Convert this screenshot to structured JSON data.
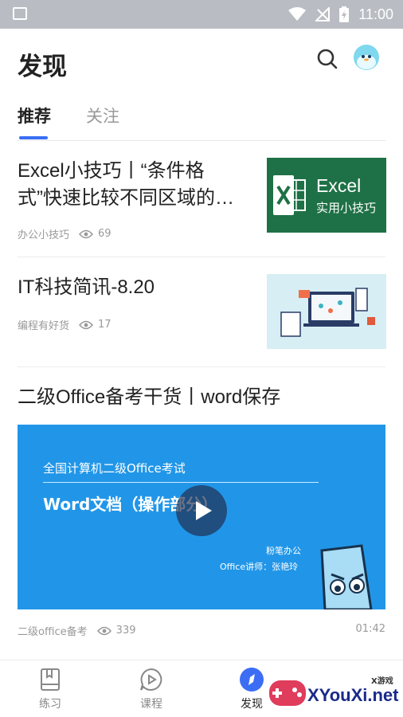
{
  "status_bar": {
    "time": "11:00"
  },
  "header": {
    "title": "发现"
  },
  "tabs": [
    {
      "label": "推荐",
      "active": true
    },
    {
      "label": "关注",
      "active": false
    }
  ],
  "articles": [
    {
      "title": "Excel小技巧丨“条件格式”快速比较不同区域的…",
      "source": "办公小技巧",
      "views": "69",
      "thumbnail": {
        "brand": "Excel",
        "caption": "实用小技巧"
      }
    },
    {
      "title": "IT科技简讯-8.20",
      "source": "编程有好货",
      "views": "17"
    },
    {
      "title": "二级Office备考干货丨word保存",
      "source": "二级office备考",
      "views": "339",
      "duration": "01:42",
      "video": {
        "exam_title": "全国计算机二级Office考试",
        "doc_title": "Word文档（操作部分）",
        "brand": "粉笔办公",
        "teacher": "Office讲师：张艳玲"
      }
    }
  ],
  "bottom_nav": [
    {
      "label": "练习",
      "icon": "book-icon",
      "active": false
    },
    {
      "label": "课程",
      "icon": "play-bubble-icon",
      "active": false
    },
    {
      "label": "发现",
      "icon": "compass-icon",
      "active": true
    }
  ],
  "watermark": {
    "text": "XYouXi.net",
    "sub": "X游戏"
  },
  "colors": {
    "accent": "#3b6ef5",
    "excel_green": "#1e7146",
    "video_blue": "#2196e8"
  }
}
